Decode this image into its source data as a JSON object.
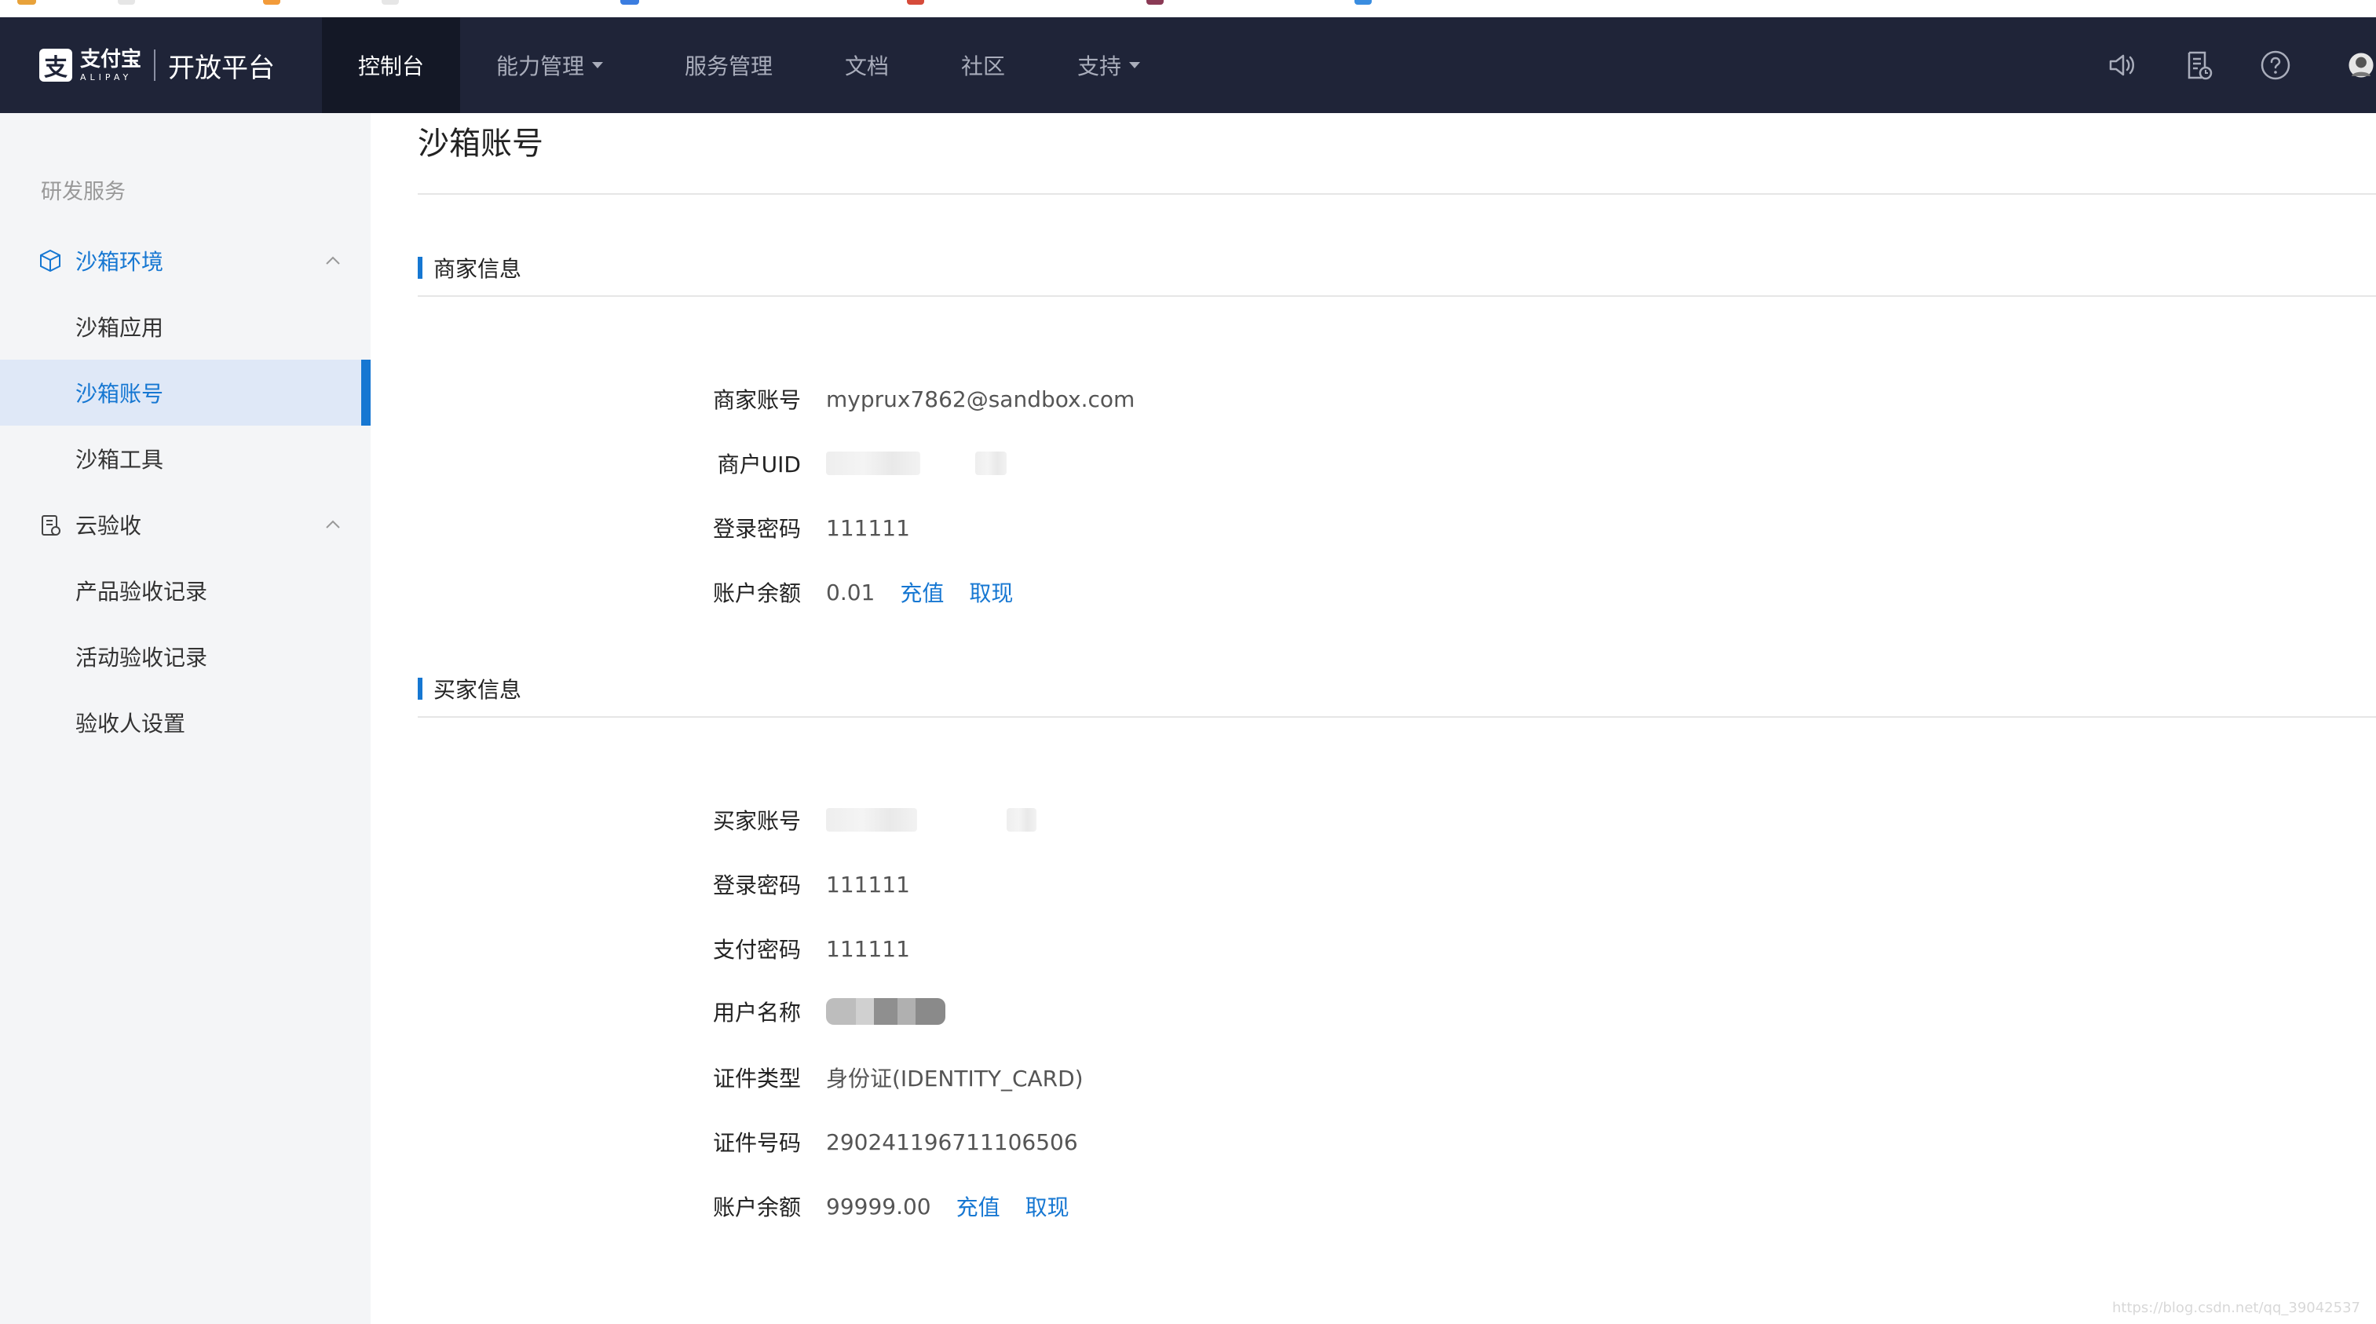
{
  "header": {
    "logo_cn": "支付宝",
    "logo_en": "ALIPAY",
    "platform": "开放平台",
    "nav": [
      {
        "label": "控制台"
      },
      {
        "label": "能力管理"
      },
      {
        "label": "服务管理"
      },
      {
        "label": "文档"
      },
      {
        "label": "社区"
      },
      {
        "label": "支持"
      }
    ],
    "icons": [
      "speaker-icon",
      "document-clock-icon",
      "help-icon",
      "avatar"
    ]
  },
  "sidebar": {
    "heading": "研发服务",
    "groups": [
      {
        "label": "沙箱环境",
        "icon": "box-icon",
        "items": [
          "沙箱应用",
          "沙箱账号",
          "沙箱工具"
        ]
      },
      {
        "label": "云验收",
        "icon": "clipboard-icon",
        "items": [
          "产品验收记录",
          "活动验收记录",
          "验收人设置"
        ]
      }
    ]
  },
  "main": {
    "title": "沙箱账号",
    "merchant": {
      "title": "商家信息",
      "rows": [
        {
          "label": "商家账号",
          "value": "myprux7862@sandbox.com"
        },
        {
          "label": "商户UID",
          "value": ""
        },
        {
          "label": "登录密码",
          "value": "111111"
        },
        {
          "label": "账户余额",
          "value": "0.01"
        }
      ],
      "recharge": "充值",
      "withdraw": "取现"
    },
    "buyer": {
      "title": "买家信息",
      "rows": [
        {
          "label": "买家账号",
          "value": ""
        },
        {
          "label": "登录密码",
          "value": "111111"
        },
        {
          "label": "支付密码",
          "value": "111111"
        },
        {
          "label": "用户名称",
          "value": ""
        },
        {
          "label": "证件类型",
          "value": "身份证(IDENTITY_CARD)"
        },
        {
          "label": "证件号码",
          "value": "290241196711106506"
        },
        {
          "label": "账户余额",
          "value": "99999.00"
        }
      ],
      "recharge": "充值",
      "withdraw": "取现"
    }
  },
  "colors": {
    "topbar": "#1f2438",
    "accent": "#1677d2",
    "sidebar_bg": "#f4f5f7"
  },
  "watermark": "https://blog.csdn.net/qq_39042537"
}
